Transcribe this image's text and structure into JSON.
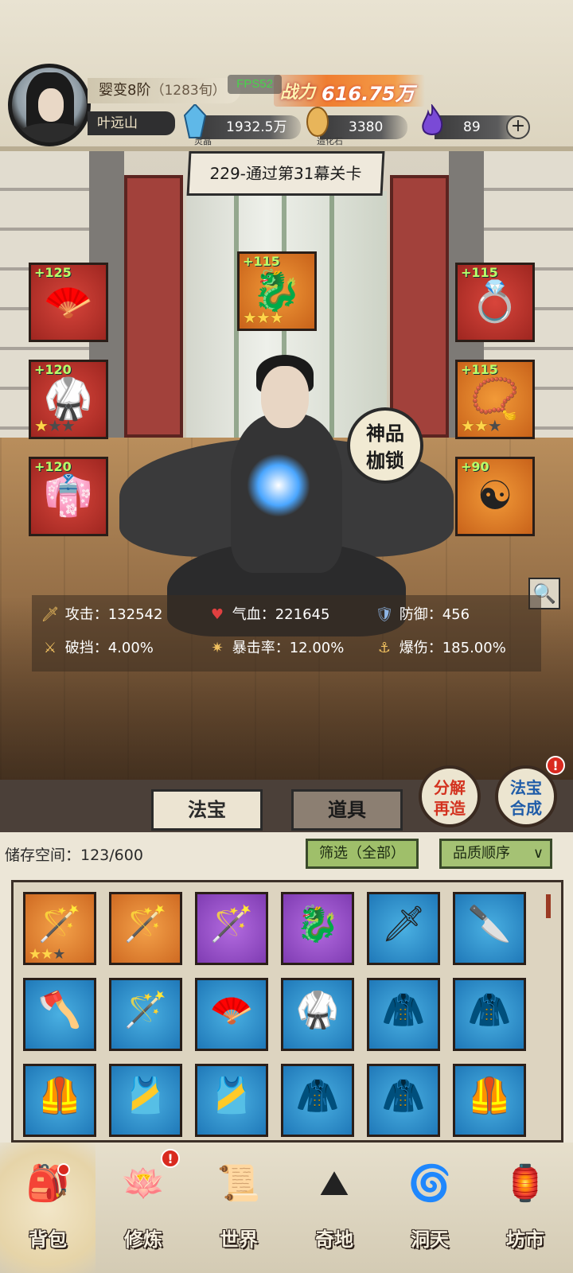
{
  "player": {
    "realm": "婴变8阶",
    "age": "（1283旬）",
    "name": "叶远山"
  },
  "fps": "FPS52",
  "combat_power": {
    "label": "战力",
    "value": "616.75万"
  },
  "resources": [
    {
      "icon": "spirit-crystal-icon",
      "caption": "灵晶",
      "value": "1932.5万"
    },
    {
      "icon": "creation-stone-icon",
      "caption": "造化石",
      "value": "3380"
    },
    {
      "icon": "spirit-flame-icon",
      "caption": "",
      "value": "89"
    }
  ],
  "stage": {
    "label": "229-通过第31幕关卡"
  },
  "equipment": {
    "left": [
      {
        "level": "+125",
        "glyph": "🪭",
        "stars": [
          0,
          0,
          0
        ],
        "show_stars": false,
        "quality": "red"
      },
      {
        "level": "+120",
        "glyph": "🥋",
        "stars": [
          1,
          0,
          0
        ],
        "show_stars": true,
        "quality": "red"
      },
      {
        "level": "+120",
        "glyph": "👘",
        "stars": [
          0,
          0,
          0
        ],
        "show_stars": false,
        "quality": "red"
      }
    ],
    "center": {
      "level": "+115",
      "glyph": "🐉",
      "stars": [
        1,
        1,
        1
      ],
      "show_stars": true,
      "quality": "orange"
    },
    "right": [
      {
        "level": "+115",
        "glyph": "💍",
        "stars": [
          0,
          0,
          0
        ],
        "show_stars": false,
        "quality": "red"
      },
      {
        "level": "+115",
        "glyph": "📿",
        "stars": [
          1,
          1,
          0
        ],
        "show_stars": true,
        "quality": "orange"
      },
      {
        "level": "+90",
        "glyph": "☯",
        "stars": [
          0,
          0,
          0
        ],
        "show_stars": false,
        "quality": "orange"
      }
    ]
  },
  "shenpin_button": {
    "line1": "神品",
    "line2": "枷锁"
  },
  "stats": [
    {
      "icon": "sword-icon",
      "glyph": "🗡",
      "label": "攻击：132542",
      "color": "#f0c060"
    },
    {
      "icon": "heart-icon",
      "glyph": "♥",
      "label": "气血：221645",
      "color": "#e04040"
    },
    {
      "icon": "shield-icon",
      "glyph": "🛡",
      "label": "防御：456",
      "color": "#8fb6e6"
    },
    {
      "icon": "break-icon",
      "glyph": "⚔",
      "label": "破挡：4.00%",
      "color": "#f0c060"
    },
    {
      "icon": "crit-icon",
      "glyph": "✷",
      "label": "暴击率：12.00%",
      "color": "#f0c060"
    },
    {
      "icon": "crit-damage-icon",
      "glyph": "⚓",
      "label": "爆伤：185.00%",
      "color": "#f0c060"
    }
  ],
  "tabs": {
    "active": "法宝",
    "inactive": "道具"
  },
  "round_buttons": [
    {
      "line1": "分解",
      "line2": "再造"
    },
    {
      "line1": "法宝",
      "line2": "合成",
      "badge": "!"
    }
  ],
  "inventory": {
    "storage": "储存空间：123/600",
    "filter": "筛选（全部）",
    "sort": "品质顺序",
    "items": [
      {
        "quality": "orange",
        "glyph": "🪄",
        "stars": [
          1,
          1,
          0
        ],
        "show_stars": true
      },
      {
        "quality": "orange",
        "glyph": "🪄",
        "show_stars": false
      },
      {
        "quality": "purple",
        "glyph": "🪄",
        "show_stars": false
      },
      {
        "quality": "purple",
        "glyph": "🐉",
        "show_stars": false
      },
      {
        "quality": "blue",
        "glyph": "🗡",
        "show_stars": false
      },
      {
        "quality": "blue",
        "glyph": "🔪",
        "show_stars": false
      },
      {
        "quality": "blue",
        "glyph": "🪓",
        "show_stars": false
      },
      {
        "quality": "blue",
        "glyph": "🪄",
        "show_stars": false
      },
      {
        "quality": "blue",
        "glyph": "🪭",
        "show_stars": false
      },
      {
        "quality": "blue",
        "glyph": "🥋",
        "show_stars": false
      },
      {
        "quality": "blue",
        "glyph": "🧥",
        "show_stars": false
      },
      {
        "quality": "blue",
        "glyph": "🧥",
        "show_stars": false
      },
      {
        "quality": "blue",
        "glyph": "🦺",
        "show_stars": false
      },
      {
        "quality": "blue",
        "glyph": "🎽",
        "show_stars": false
      },
      {
        "quality": "blue",
        "glyph": "🎽",
        "show_stars": false
      },
      {
        "quality": "blue",
        "glyph": "🧥",
        "show_stars": false
      },
      {
        "quality": "blue",
        "glyph": "🧥",
        "show_stars": false
      },
      {
        "quality": "blue",
        "glyph": "🦺",
        "show_stars": false
      }
    ]
  },
  "nav": [
    {
      "label": "背包",
      "glyph": "🎒",
      "icon": "backpack-icon",
      "badge": "",
      "active": true
    },
    {
      "label": "修炼",
      "glyph": "🪷",
      "icon": "lotus-icon",
      "badge": "!",
      "active": false
    },
    {
      "label": "世界",
      "glyph": "📜",
      "icon": "scroll-map-icon",
      "badge": "",
      "active": false
    },
    {
      "label": "奇地",
      "glyph": "⛰",
      "icon": "mountain-icon",
      "badge": "",
      "active": false
    },
    {
      "label": "洞天",
      "glyph": "🌀",
      "icon": "portal-icon",
      "badge": "",
      "active": false
    },
    {
      "label": "坊市",
      "glyph": "🏮",
      "icon": "market-icon",
      "badge": "",
      "active": false
    }
  ],
  "colors": {
    "equip_red": "#c9352c",
    "equip_orange": "#e58a30",
    "level_green": "#b9ff6b",
    "star_gold": "#ffd54a",
    "filter_green": "#9fbf6a"
  }
}
